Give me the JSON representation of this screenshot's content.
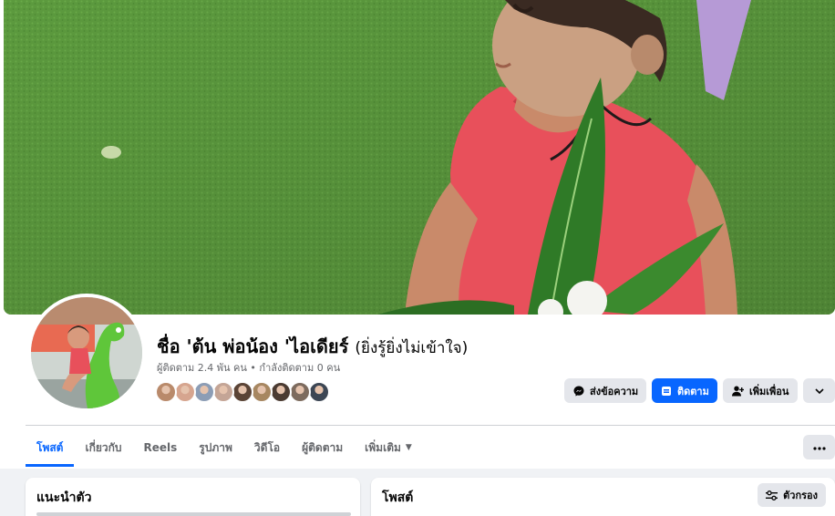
{
  "profile": {
    "name": "ชื่อ 'ต้น พ่อน้อง 'ไอเดียร์",
    "alternate_name": "(ยิ่งรู้ยิ่งไม่เข้าใจ)",
    "stats": "ผู้ติดตาม 2.4 พัน คน • กำลังติดตาม 0 คน"
  },
  "follower_avatar_colors": [
    "#b98a6b",
    "#d6a58f",
    "#8c9db5",
    "#c4a596",
    "#5b4436",
    "#a78761",
    "#4b3b32",
    "#7d6b5e",
    "#3c4654"
  ],
  "actions": {
    "message_label": "ส่งข้อความ",
    "follow_label": "ติดตาม",
    "add_friend_label": "เพิ่มเพื่อน"
  },
  "tabs": [
    {
      "label": "โพสต์",
      "active": true
    },
    {
      "label": "เกี่ยวกับ"
    },
    {
      "label": "Reels"
    },
    {
      "label": "รูปภาพ"
    },
    {
      "label": "วิดีโอ"
    },
    {
      "label": "ผู้ติดตาม"
    },
    {
      "label": "เพิ่มเติม",
      "has_caret": true
    }
  ],
  "tab_more_icon": "ellipsis-icon",
  "intro": {
    "title": "แนะนำตัว"
  },
  "posts": {
    "title": "โพสต์",
    "filter_label": "ตัวกรอง"
  },
  "colors": {
    "accent": "#0866ff",
    "secondary_button": "#e4e6eb",
    "muted_text": "#65676b",
    "feed_background": "#f0f2f5",
    "cover_grass": "#5c9a3e",
    "dress": "#e8505b"
  }
}
